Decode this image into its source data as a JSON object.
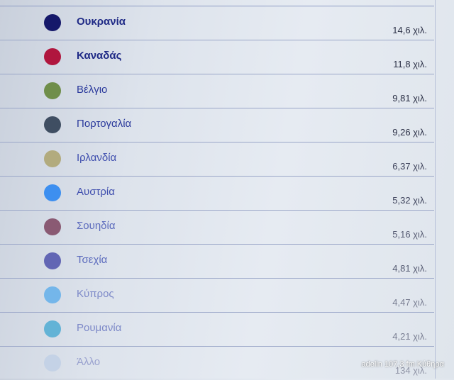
{
  "items": [
    {
      "name": "Ουκρανία",
      "value": "14,6 χιλ.",
      "color": "#15186a"
    },
    {
      "name": "Καναδάς",
      "value": "11,8 χιλ.",
      "color": "#b0163e"
    },
    {
      "name": "Βέλγιο",
      "value": "9,81 χιλ.",
      "color": "#6f8e4a"
    },
    {
      "name": "Πορτογαλία",
      "value": "9,26 χιλ.",
      "color": "#3f4e62"
    },
    {
      "name": "Ιρλανδία",
      "value": "6,37 χιλ.",
      "color": "#b2ab7e"
    },
    {
      "name": "Αυστρία",
      "value": "5,32 χιλ.",
      "color": "#3d8ff0"
    },
    {
      "name": "Σουηδία",
      "value": "5,16 χιλ.",
      "color": "#8a5a73"
    },
    {
      "name": "Τσεχία",
      "value": "4,81 χιλ.",
      "color": "#6266b4"
    },
    {
      "name": "Κύπρος",
      "value": "4,47 χιλ.",
      "color": "#74b6ea"
    },
    {
      "name": "Ρουμανία",
      "value": "4,21 χιλ.",
      "color": "#63b3d6"
    },
    {
      "name": "Άλλο",
      "value": "134 χιλ.",
      "color": "#c4d2e6"
    }
  ],
  "watermark": "adelin 107,3 fm Κύθηρα"
}
